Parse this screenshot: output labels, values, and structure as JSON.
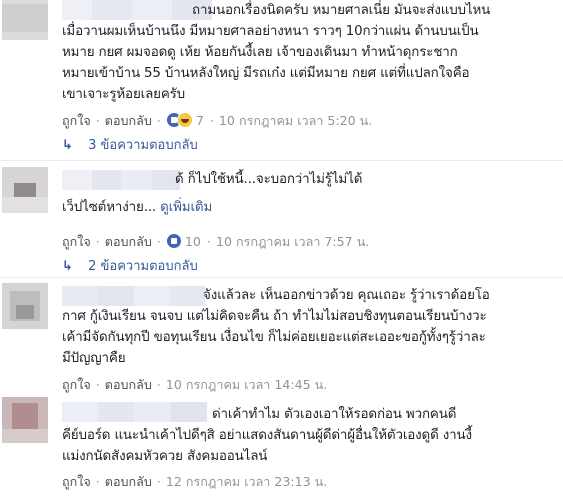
{
  "comments": [
    {
      "lines": [
        "ถามนอกเรื่องนิดครับ หมายศาลเนี่ย มันจะส่งแบบไหน",
        "เมื่อวานผมเห็นบ้านนึง มีหมายศาลอย่างหนา ราวๆ 10กว่าแผ่น ด้านบนเป็น",
        "หมาย กยศ ผมจอดดู เห้ย ห้อยกันงี้เลย เจ้าของเดินมา ทำหน้าดุกระชาก",
        "หมายเข้าบ้าน 55 บ้านหลังใหญ่ มีรถเก๋ง แต่มีหมาย กยศ แต่ที่แปลกใจคือ",
        "เขาเจาะรูห้อยเลยครับ"
      ],
      "like_label": "ถูกใจ",
      "reply_label": "ตอบกลับ",
      "reaction_icons": [
        "like-icon",
        "haha-icon"
      ],
      "reaction_count": "7",
      "timestamp": "10 กรกฎาคม เวลา 5:20 น.",
      "replies_label": "3 ข้อความตอบกลับ"
    },
    {
      "lines": [
        "ด้ ก็ไปใช้หนี้...จะบอกว่าไม่รู้ไม่ได้",
        "เว็ปไซต์หาง่าย... ดูเพิ่มเติม"
      ],
      "see_more": "ดูเพิ่มเติม",
      "like_label": "ถูกใจ",
      "reply_label": "ตอบกลับ",
      "reaction_icons": [
        "like-icon"
      ],
      "reaction_count": "10",
      "timestamp": "10 กรกฎาคม เวลา 7:57 น.",
      "replies_label": "2 ข้อความตอบกลับ"
    },
    {
      "lines": [
        "จังแล้วละ เห็นออกข่าวด้วย คุณเถอะ รู้ว่าเราด้อยโอ",
        "กาศ กู้เงินเรียน จนจบ แต่ไม่คิดจะคืน ถ้า ทำไมไม่สอบชิงทุนตอนเรียนบ้างวะ",
        "เค้ามีจัดกันทุกปี ขอทุนเรียน เงื่อนไข ก็ไม่ค่อยเยอะแต่สะเออะขอกู้ทั้งๆรู้ว่าละ",
        "มีปัญญาคืย"
      ],
      "like_label": "ถูกใจ",
      "reply_label": "ตอบกลับ",
      "timestamp": "10 กรกฎาคม เวลา 14:45 น."
    },
    {
      "lines": [
        "ด่าเค้าทำไม ตัวเองเอาให้รอดก่อน พวกคนดี",
        "คีย์บอร์ด แนะนำเค้าไปดีๆสิ อย่าแสดงสันดานผู้ดีด่าผู้อื่นให้ตัวเองดูดี งานงี้",
        "แม่งกนัดสังคมหัวควย สังคมออนไลน์"
      ],
      "like_label": "ถูกใจ",
      "reply_label": "ตอบกลับ",
      "timestamp": "12 กรกฎาคม เวลา 23:13 น."
    }
  ],
  "colors": {
    "text": "#1d2129",
    "link": "#365899",
    "meta": "#90949c",
    "action": "#4b4f56",
    "like": "#4267b2",
    "haha": "#f7c842"
  }
}
